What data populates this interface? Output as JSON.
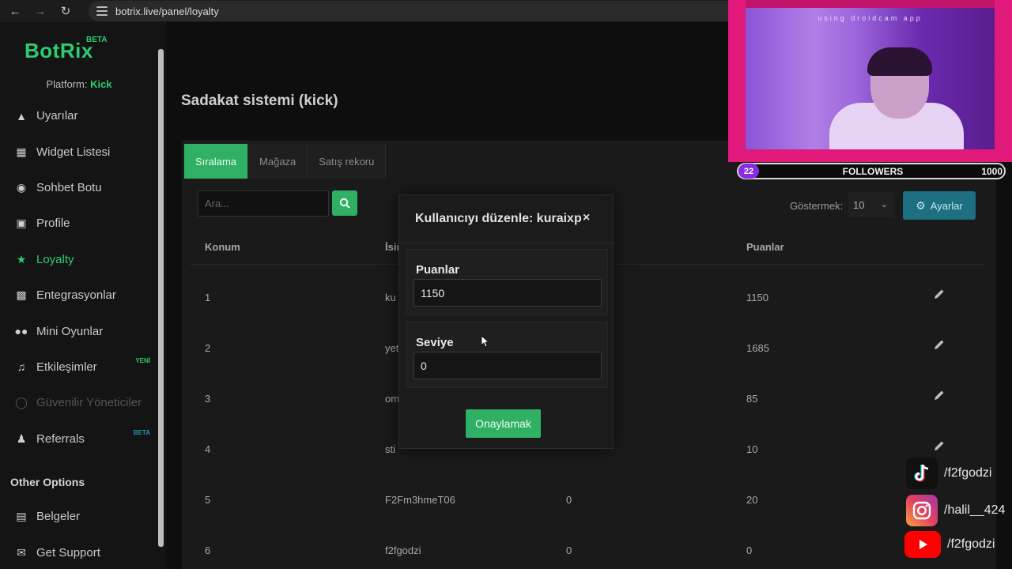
{
  "browser": {
    "url": "botrix.live/panel/loyalty"
  },
  "sidebar": {
    "logo": "BotRix",
    "logo_badge": "BETA",
    "platform_label": "Platform:",
    "platform_value": "Kick",
    "items": [
      {
        "label": "Uyarılar",
        "icon": "warning-icon"
      },
      {
        "label": "Widget Listesi",
        "icon": "grid-icon"
      },
      {
        "label": "Sohbet Botu",
        "icon": "robot-icon"
      },
      {
        "label": "Profile",
        "icon": "id-card-icon"
      },
      {
        "label": "Loyalty",
        "icon": "trophy-icon",
        "active": true
      },
      {
        "label": "Entegrasyonlar",
        "icon": "plug-icon"
      },
      {
        "label": "Mini Oyunlar",
        "icon": "gamepad-icon"
      },
      {
        "label": "Etkileşimler",
        "icon": "music-icon",
        "badge": "YENİ"
      },
      {
        "label": "Güvenilir Yöneticiler",
        "icon": "shield-icon",
        "disabled": true
      },
      {
        "label": "Referrals",
        "icon": "users-icon",
        "badge": "BETA"
      }
    ],
    "other_options_title": "Other Options",
    "other_items": [
      {
        "label": "Belgeler",
        "icon": "docs-icon"
      },
      {
        "label": "Get Support",
        "icon": "support-icon"
      }
    ]
  },
  "main": {
    "page_title": "Sadakat sistemi (kick)",
    "tabs": [
      {
        "label": "Sıralama",
        "active": true
      },
      {
        "label": "Mağaza"
      },
      {
        "label": "Satış rekoru"
      }
    ],
    "search_placeholder": "Ara...",
    "show_label": "Göstermek:",
    "show_value": "10",
    "settings_label": "Ayarlar",
    "table": {
      "headers": [
        "Konum",
        "İsim",
        "",
        "Puanlar"
      ],
      "rows": [
        {
          "pos": "1",
          "name": "ku",
          "level": "",
          "points": "1150"
        },
        {
          "pos": "2",
          "name": "yet",
          "level": "",
          "points": "1685"
        },
        {
          "pos": "3",
          "name": "om",
          "level": "",
          "points": "85"
        },
        {
          "pos": "4",
          "name": "sti",
          "level": "",
          "points": "10"
        },
        {
          "pos": "5",
          "name": "F2Fm3hmeT06",
          "level": "0",
          "points": "20"
        },
        {
          "pos": "6",
          "name": "f2fgodzi",
          "level": "0",
          "points": "0"
        }
      ]
    }
  },
  "modal": {
    "title": "Kullanıcıyı düzenle: kuraixp",
    "close": "×",
    "points_label": "Puanlar",
    "points_value": "1150",
    "level_label": "Seviye",
    "level_value": "0",
    "confirm_label": "Onaylamak"
  },
  "overlay": {
    "cam_text": "using droidcam app",
    "followers_current": "22",
    "followers_label": "FOLLOWERS",
    "followers_goal": "1000",
    "socials": [
      {
        "platform": "tiktok",
        "handle": "/f2fgodzi"
      },
      {
        "platform": "instagram",
        "handle": "/halil__424"
      },
      {
        "platform": "youtube",
        "handle": "/f2fgodzi"
      }
    ]
  },
  "colors": {
    "accent_green": "#2fb064",
    "brand_green": "#2ecc71",
    "settings_blue": "#1e6f82",
    "frame_pink": "#e0197a"
  }
}
